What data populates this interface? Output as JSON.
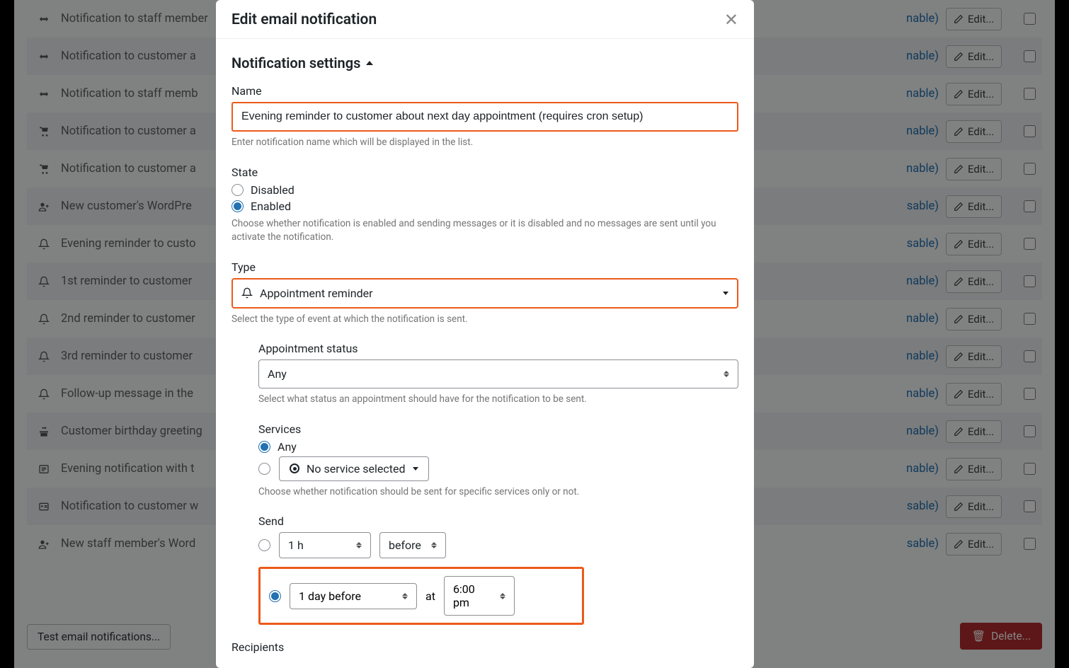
{
  "modal": {
    "title": "Edit email notification",
    "section_title": "Notification settings",
    "name_label": "Name",
    "name_value": "Evening reminder to customer about next day appointment (requires cron setup)",
    "name_help": "Enter notification name which will be displayed in the list.",
    "state_label": "State",
    "state_disabled": "Disabled",
    "state_enabled": "Enabled",
    "state_help": "Choose whether notification is enabled and sending messages or it is disabled and no messages are sent until you activate the notification.",
    "type_label": "Type",
    "type_value": "Appointment reminder",
    "type_help": "Select the type of event at which the notification is sent.",
    "appt_status_label": "Appointment status",
    "appt_status_value": "Any",
    "appt_status_help": "Select what status an appointment should have for the notification to be sent.",
    "services_label": "Services",
    "services_any": "Any",
    "no_service_selected": "No service selected",
    "services_help": "Choose whether notification should be sent for specific services only or not.",
    "send_label": "Send",
    "send_1h": "1 h",
    "send_before": "before",
    "send_1day_before": "1 day before",
    "send_at": "at",
    "send_time": "6:00 pm",
    "recipients_label": "Recipients"
  },
  "bg_rows": [
    {
      "icon": "arrows",
      "title": "Notification to staff member",
      "link": "nable)"
    },
    {
      "icon": "arrows",
      "title": "Notification to customer a",
      "link": "nable)"
    },
    {
      "icon": "arrows",
      "title": "Notification to staff memb",
      "link": "nable)"
    },
    {
      "icon": "cart",
      "title": "Notification to customer a",
      "link": "nable)"
    },
    {
      "icon": "cart",
      "title": "Notification to customer a",
      "link": "nable)"
    },
    {
      "icon": "user-plus",
      "title": "New customer's WordPre",
      "link": "sable)"
    },
    {
      "icon": "bell",
      "title": "Evening reminder to custo",
      "link": "sable)"
    },
    {
      "icon": "bell",
      "title": "1st reminder to customer",
      "link": "nable)"
    },
    {
      "icon": "bell",
      "title": "2nd reminder to customer",
      "link": "nable)"
    },
    {
      "icon": "bell",
      "title": "3rd reminder to customer",
      "link": "nable)"
    },
    {
      "icon": "bell",
      "title": "Follow-up message in the",
      "link": "nable)"
    },
    {
      "icon": "gift",
      "title": "Customer birthday greeting",
      "link": "nable)"
    },
    {
      "icon": "list",
      "title": "Evening notification with t",
      "link": "nable)"
    },
    {
      "icon": "card",
      "title": "Notification to customer w",
      "link": "sable)"
    },
    {
      "icon": "user-plus",
      "title": "New staff member's Word",
      "link": "sable)"
    }
  ],
  "buttons": {
    "edit": "Edit...",
    "test_email": "Test email notifications...",
    "delete": "Delete..."
  }
}
